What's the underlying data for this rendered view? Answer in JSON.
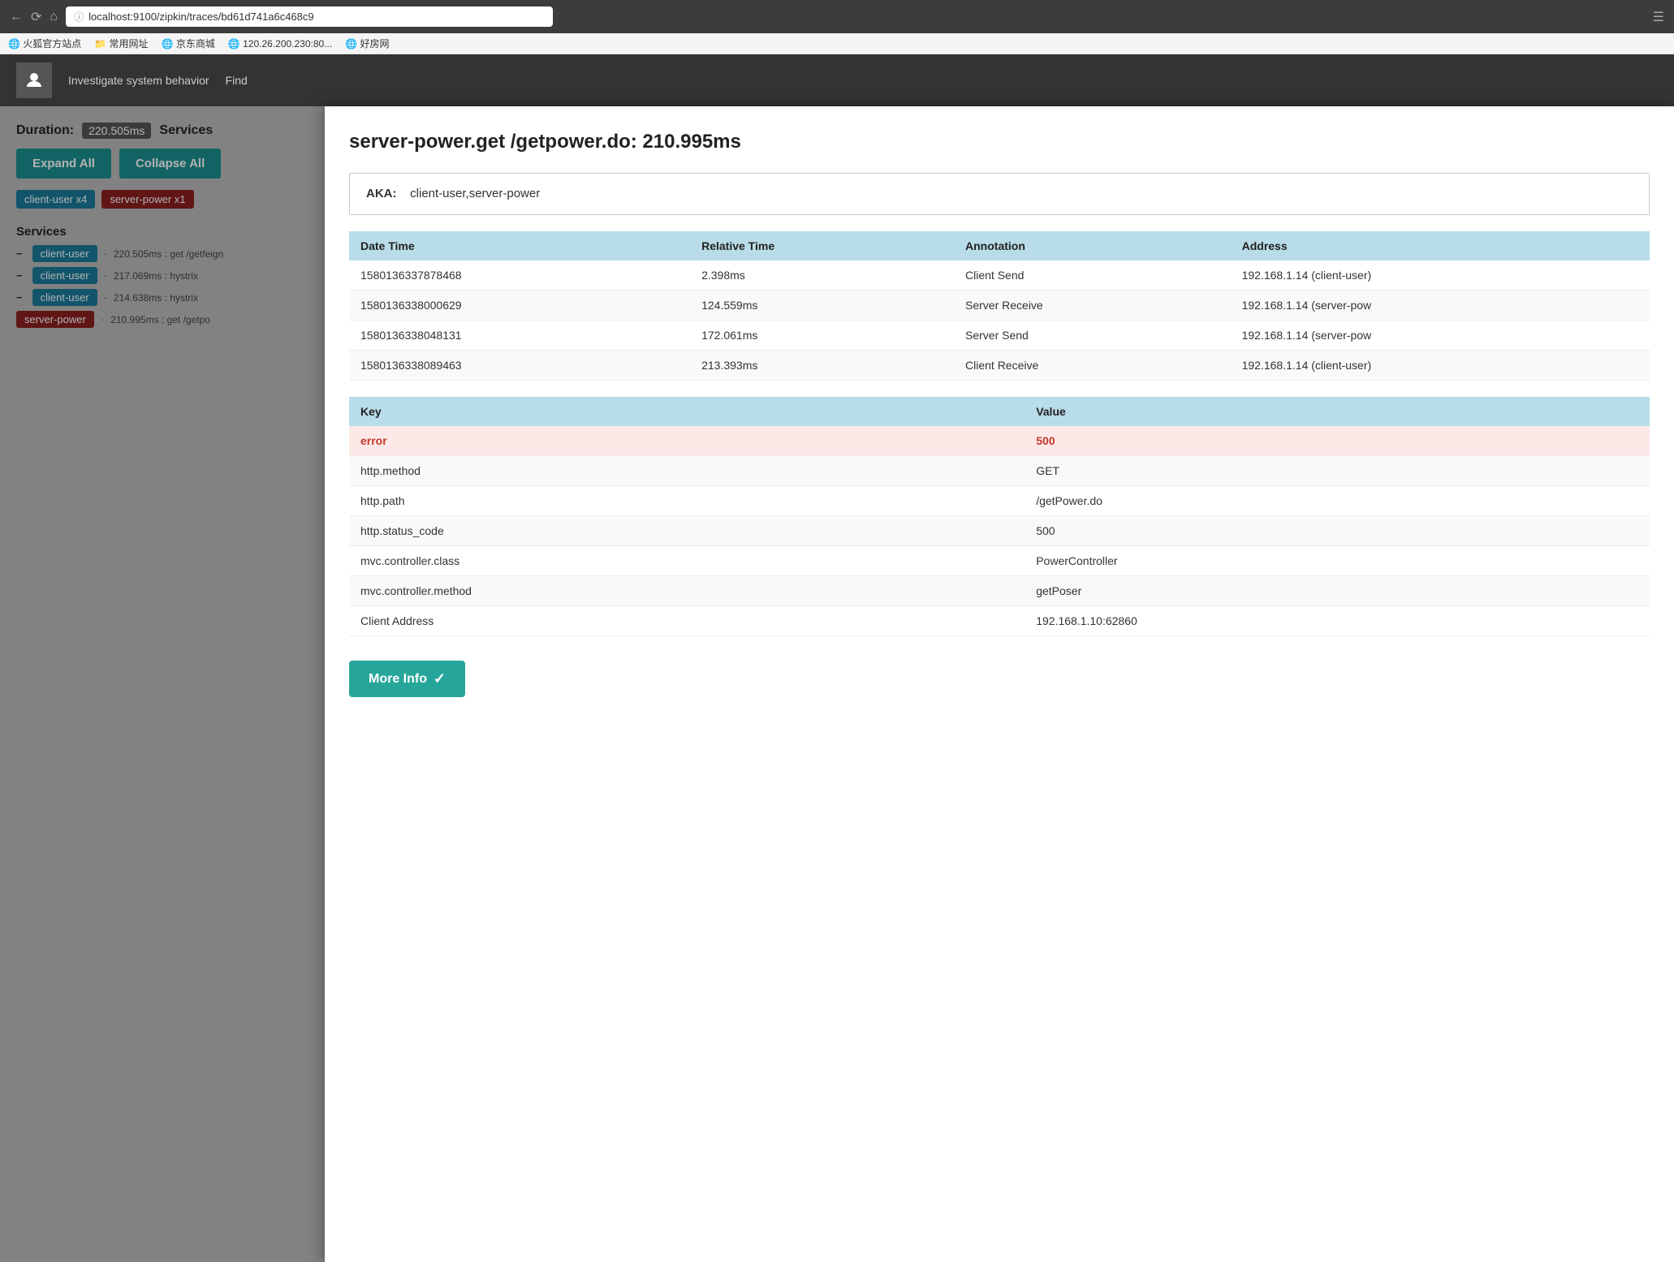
{
  "browser": {
    "url": "localhost:9100/zipkin/traces/bd61d741a6c468c9",
    "bookmarks": [
      "火狐官方站点",
      "常用网址",
      "京东商城",
      "120.26.200.230:80...",
      "好房网"
    ]
  },
  "app_header": {
    "nav_items": [
      "Investigate system behavior",
      "Find"
    ]
  },
  "left_panel": {
    "duration_label": "Duration:",
    "duration_value": "220.505ms",
    "services_label": "Services",
    "expand_all_label": "Expand All",
    "collapse_all_label": "Collapse All",
    "tags": [
      "client-user x4",
      "server-power x1"
    ],
    "services_section_title": "Services",
    "service_rows": [
      {
        "type": "client",
        "label": "client-user",
        "has_minus": true,
        "trace": "220.505ms : get /getfeign"
      },
      {
        "type": "client",
        "label": "client-user",
        "has_minus": true,
        "trace": "217.069ms : hystrix"
      },
      {
        "type": "client",
        "label": "client-user",
        "has_minus": true,
        "trace": "214.638ms : hystrix"
      },
      {
        "type": "server",
        "label": "server-power",
        "has_minus": false,
        "trace": "210.995ms : get /getpo"
      }
    ]
  },
  "modal": {
    "title": "server-power.get /getpower.do: 210.995ms",
    "aka_label": "AKA:",
    "aka_value": "client-user,server-power",
    "annotations_table": {
      "columns": [
        "Date Time",
        "Relative Time",
        "Annotation",
        "Address"
      ],
      "rows": [
        {
          "date_time": "1580136337878468",
          "relative_time": "2.398ms",
          "annotation": "Client Send",
          "address": "192.168.1.14 (client-user)"
        },
        {
          "date_time": "1580136338000629",
          "relative_time": "124.559ms",
          "annotation": "Server Receive",
          "address": "192.168.1.14 (server-pow"
        },
        {
          "date_time": "1580136338048131",
          "relative_time": "172.061ms",
          "annotation": "Server Send",
          "address": "192.168.1.14 (server-pow"
        },
        {
          "date_time": "1580136338089463",
          "relative_time": "213.393ms",
          "annotation": "Client Receive",
          "address": "192.168.1.14 (client-user)"
        }
      ]
    },
    "tags_table": {
      "columns": [
        "Key",
        "Value"
      ],
      "rows": [
        {
          "key": "error",
          "value": "500",
          "is_error": true
        },
        {
          "key": "http.method",
          "value": "GET",
          "is_error": false
        },
        {
          "key": "http.path",
          "value": "/getPower.do",
          "is_error": false
        },
        {
          "key": "http.status_code",
          "value": "500",
          "is_error": false
        },
        {
          "key": "mvc.controller.class",
          "value": "PowerController",
          "is_error": false
        },
        {
          "key": "mvc.controller.method",
          "value": "getPoser",
          "is_error": false
        },
        {
          "key": "Client Address",
          "value": "192.168.1.10:62860",
          "is_error": false
        }
      ]
    },
    "more_info_label": "More Info"
  }
}
